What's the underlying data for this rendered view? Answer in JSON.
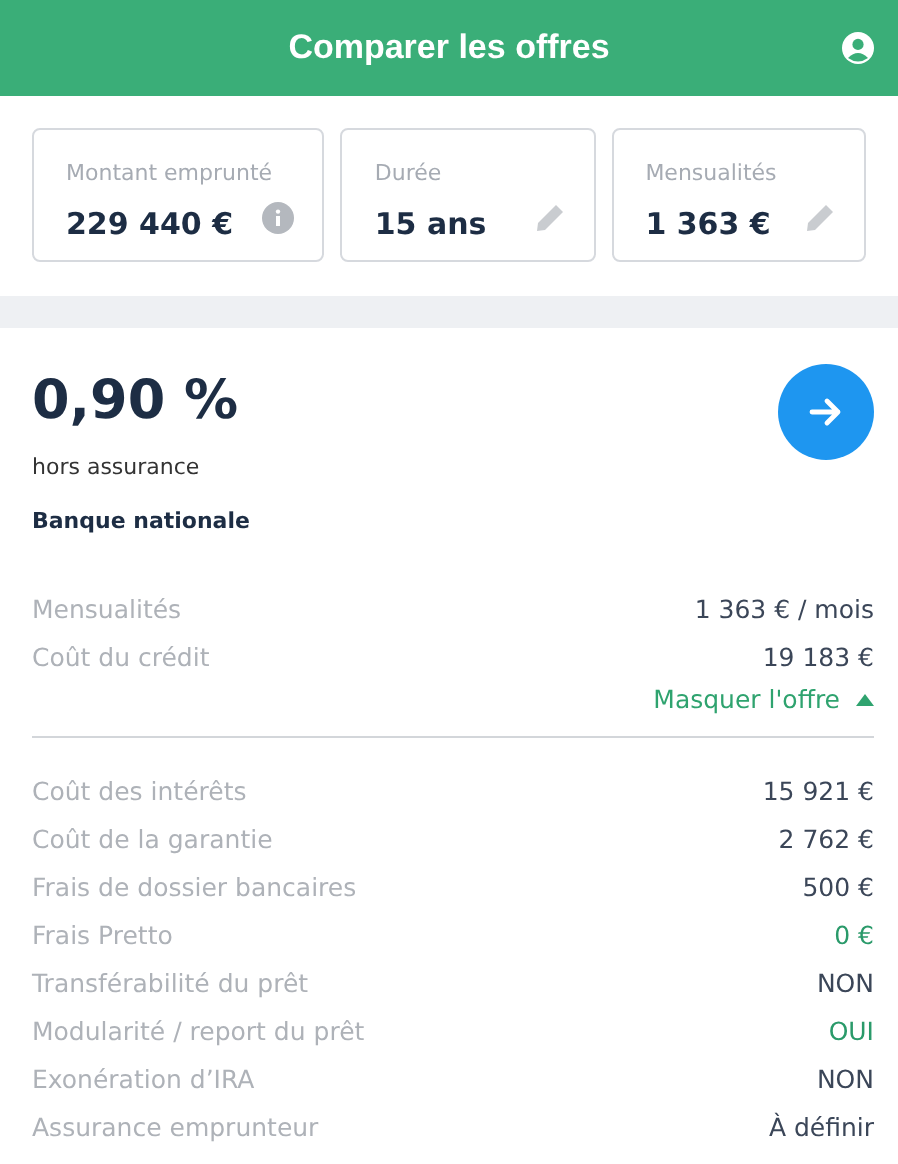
{
  "header": {
    "title": "Comparer les offres"
  },
  "fields": [
    {
      "label": "Montant emprunté",
      "value": "229 440 €",
      "kind": "info"
    },
    {
      "label": "Durée",
      "value": "15 ans",
      "kind": "edit"
    },
    {
      "label": "Mensualités",
      "value": "1 363 €",
      "kind": "edit"
    }
  ],
  "offer": {
    "rate": "0,90 %",
    "rate_note": "hors assurance",
    "bank": "Banque nationale",
    "summary": [
      {
        "label": "Mensualités",
        "value": "1 363 € / mois"
      },
      {
        "label": "Coût du crédit",
        "value": "19 183 €"
      }
    ],
    "toggle": {
      "label": "Masquer l'offre",
      "expanded": true
    },
    "details": [
      {
        "label": "Coût des intérêts",
        "value": "15 921 €",
        "highlight": false
      },
      {
        "label": "Coût de la garantie",
        "value": "2 762 €",
        "highlight": false
      },
      {
        "label": "Frais de dossier bancaires",
        "value": "500 €",
        "highlight": false
      },
      {
        "label": "Frais Pretto",
        "value": "0 €",
        "highlight": true
      },
      {
        "label": "Transférabilité du prêt",
        "value": "NON",
        "highlight": false
      },
      {
        "label": "Modularité / report du prêt",
        "value": "OUI",
        "highlight": true
      },
      {
        "label": "Exonération d’IRA",
        "value": "NON",
        "highlight": false
      },
      {
        "label": "Assurance emprunteur",
        "value": "À définir",
        "highlight": false
      }
    ]
  }
}
